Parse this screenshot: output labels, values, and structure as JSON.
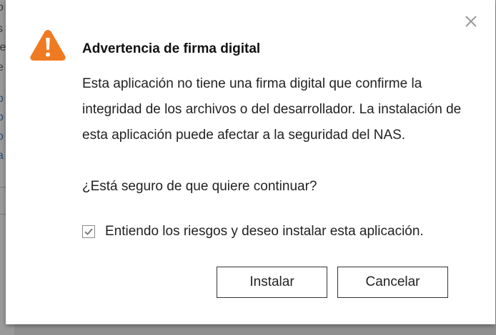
{
  "dialog": {
    "title": "Advertencia de firma digital",
    "message": "Esta aplicación no tiene una firma digital que confirme la integridad de los archivos o del desarrollador. La instalación de esta aplicación puede afectar a la seguridad del NAS.",
    "question": "¿Está seguro de que quiere continuar?",
    "checkbox_label": "Entiendo los riesgos y deseo instalar esta aplicación.",
    "checkbox_checked": true,
    "install_label": "Instalar",
    "cancel_label": "Cancelar",
    "warning_icon": "warning-icon",
    "close_icon": "close-icon",
    "accent_color": "#f07a22"
  },
  "background": {
    "fragments": [
      "o",
      "s",
      "le",
      "e",
      "o",
      "o",
      "o",
      "a"
    ]
  }
}
